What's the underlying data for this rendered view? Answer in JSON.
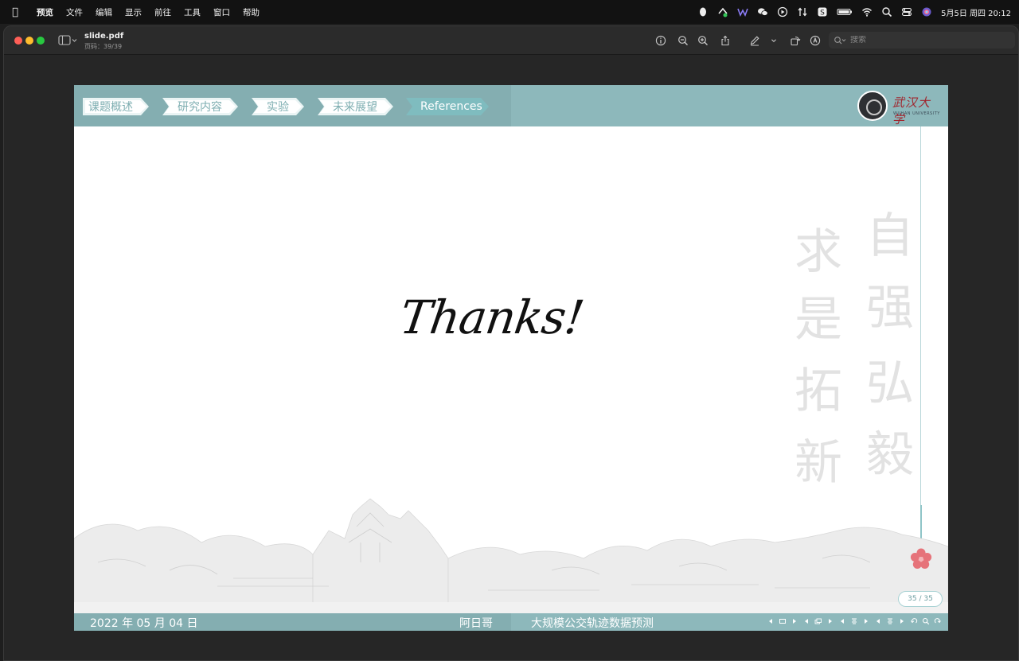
{
  "menubar": {
    "items": [
      "预览",
      "文件",
      "编辑",
      "显示",
      "前往",
      "工具",
      "窗口",
      "帮助"
    ],
    "clock": "5月5日 周四  20:12"
  },
  "window": {
    "doc_title": "slide.pdf",
    "page_info": "页码：39/39",
    "search_placeholder": "搜索"
  },
  "slide": {
    "nav_tabs": [
      {
        "label": "课题概述",
        "active": false
      },
      {
        "label": "研究内容",
        "active": false
      },
      {
        "label": "实验",
        "active": false
      },
      {
        "label": "未来展望",
        "active": false
      },
      {
        "label": "References",
        "active": true
      }
    ],
    "logo_text": "武汉大学",
    "logo_sub": "WUHAN UNIVERSITY",
    "body_text": "Thanks!",
    "calligraphy": [
      "自",
      "强",
      "弘",
      "毅",
      "求",
      "是",
      "拓",
      "新"
    ],
    "page_indicator": "35 /  35",
    "footer": {
      "date": "2022 年 05 月 04 日",
      "author": "阿日哥",
      "title": "大规模公交轨迹数据预测"
    },
    "colors": {
      "header": "#8db8bb",
      "header_dark": "#84aeb1",
      "flower": "#e6737a"
    }
  }
}
